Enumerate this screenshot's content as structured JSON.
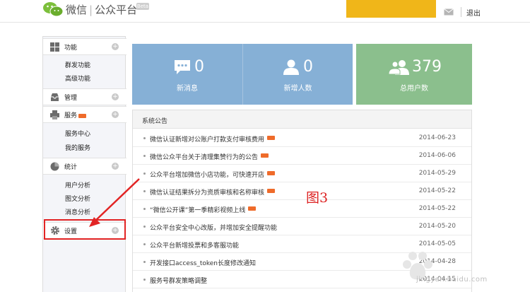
{
  "header": {
    "brand": "微信",
    "separator": "|",
    "product": "公众平台",
    "beta": "Beta",
    "logout": "退出"
  },
  "sidebar": {
    "groups": [
      {
        "label": "功能",
        "icon": "grid-icon",
        "subitems": [
          "群发功能",
          "高级功能"
        ]
      },
      {
        "label": "管理",
        "icon": "inbox-icon",
        "subitems": []
      },
      {
        "label": "服务",
        "icon": "printer-icon",
        "subitems": [
          "服务中心",
          "我的服务"
        ]
      },
      {
        "label": "统计",
        "icon": "pie-chart-icon",
        "subitems": [
          "用户分析",
          "图文分析",
          "消息分析"
        ]
      },
      {
        "label": "设置",
        "icon": "gear-icon",
        "subitems": []
      }
    ]
  },
  "stats": [
    {
      "value": "0",
      "label": "新消息",
      "icon": "chat-bubble-icon"
    },
    {
      "value": "0",
      "label": "新增人数",
      "icon": "user-icon"
    },
    {
      "value": "379",
      "label": "总用户数",
      "icon": "users-icon"
    }
  ],
  "announcements": {
    "title": "系统公告",
    "items": [
      {
        "text": "微信认证新增对公账户打款支付审核费用",
        "date": "2014-06-23",
        "is_new": true
      },
      {
        "text": "微信公众平台关于清理集赞行为的公告",
        "date": "2014-06-06",
        "is_new": true
      },
      {
        "text": "公众平台增加微信小店功能，可快速开店",
        "date": "2014-05-29",
        "is_new": true
      },
      {
        "text": "微信认证结果拆分为资质审核和名称审核",
        "date": "2014-05-22",
        "is_new": true
      },
      {
        "text": "“微信公开课”第一季精彩视频上线",
        "date": "2014-05-22",
        "is_new": true
      },
      {
        "text": "公众平台安全中心改版，并增加安全提醒功能",
        "date": "2014-05-20",
        "is_new": false
      },
      {
        "text": "公众平台新增投票和多客服功能",
        "date": "2014-05-05",
        "is_new": false
      },
      {
        "text": "开发接口access_token长度修改通知",
        "date": "2014-04-28",
        "is_new": false
      },
      {
        "text": "服务号群发策略调整",
        "date": "2014-04-15",
        "is_new": false
      }
    ]
  },
  "annotation": {
    "label": "图3"
  },
  "watermark": {
    "site": "jingyan.baidu.com",
    "brand": "Baidu经验"
  },
  "colors": {
    "tile_blue": "#86b0d6",
    "tile_green": "#8bbf8d",
    "accent_yellow": "#f0b619",
    "highlight_red": "#e22424",
    "new_tag": "#ef6b2a"
  }
}
